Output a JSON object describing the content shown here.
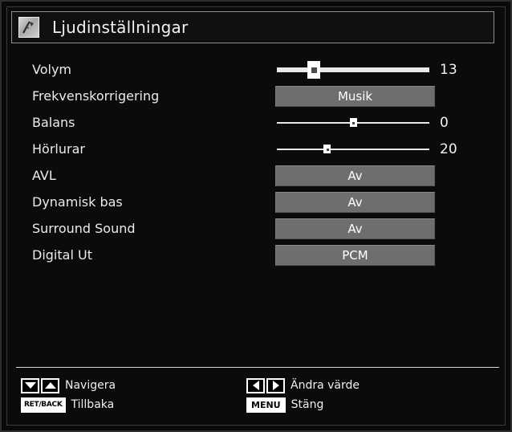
{
  "window": {
    "title": "Ljudinställningar",
    "icon": "sound-settings-icon"
  },
  "settings": [
    {
      "label": "Volym",
      "control": "slider",
      "style": "thick",
      "value": "13",
      "percent": 24
    },
    {
      "label": "Frekvenskorrigering",
      "control": "option",
      "value": "Musik"
    },
    {
      "label": "Balans",
      "control": "slider",
      "style": "thin",
      "value": "0",
      "percent": 50
    },
    {
      "label": "Hörlurar",
      "control": "slider",
      "style": "thin",
      "value": "20",
      "percent": 33
    },
    {
      "label": "AVL",
      "control": "option",
      "value": "Av"
    },
    {
      "label": "Dynamisk bas",
      "control": "option",
      "value": "Av"
    },
    {
      "label": "Surround Sound",
      "control": "option",
      "value": "Av"
    },
    {
      "label": "Digital Ut",
      "control": "option",
      "value": "PCM"
    }
  ],
  "footer": {
    "navigate": {
      "down_icon": "arrow-down-icon",
      "up_icon": "arrow-up-icon",
      "label": "Navigera"
    },
    "back": {
      "key": "RET/BACK",
      "label": "Tillbaka"
    },
    "change_value": {
      "left_icon": "arrow-left-icon",
      "right_icon": "arrow-right-icon",
      "label": "Ändra värde"
    },
    "close": {
      "key": "MENU",
      "label": "Stäng"
    }
  },
  "colors": {
    "background": "#0a0a0a",
    "text": "#f2f2f2",
    "option_box": "#6e6e6e",
    "slider": "#e9e9e9"
  }
}
